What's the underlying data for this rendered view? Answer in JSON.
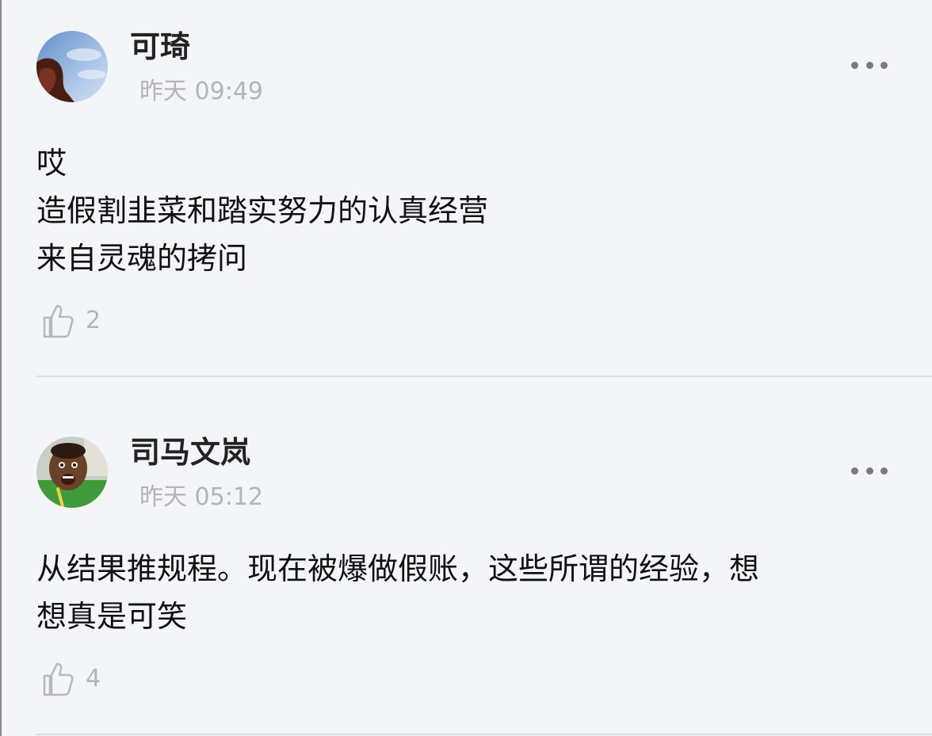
{
  "comments": [
    {
      "username": "可琦",
      "timestamp": "昨天 09:49",
      "lines": [
        "哎",
        "造假割韭菜和踏实努力的认真经营",
        "来自灵魂的拷问"
      ],
      "likes": "2",
      "avatar_icon": "user-avatar-icon",
      "more_icon": "more-dots-icon",
      "like_icon": "thumbs-up-icon"
    },
    {
      "username": "司马文岚",
      "timestamp": "昨天 05:12",
      "lines": [
        "从结果推规程。现在被爆做假账，这些所谓的经验，想",
        "想真是可笑"
      ],
      "likes": "4",
      "avatar_icon": "user-avatar-icon",
      "more_icon": "more-dots-icon",
      "like_icon": "thumbs-up-icon"
    }
  ],
  "colors": {
    "background": "#f4f5f9",
    "username": "#222222",
    "meta_gray": "#b4b4b8",
    "divider": "#dcdde1"
  }
}
